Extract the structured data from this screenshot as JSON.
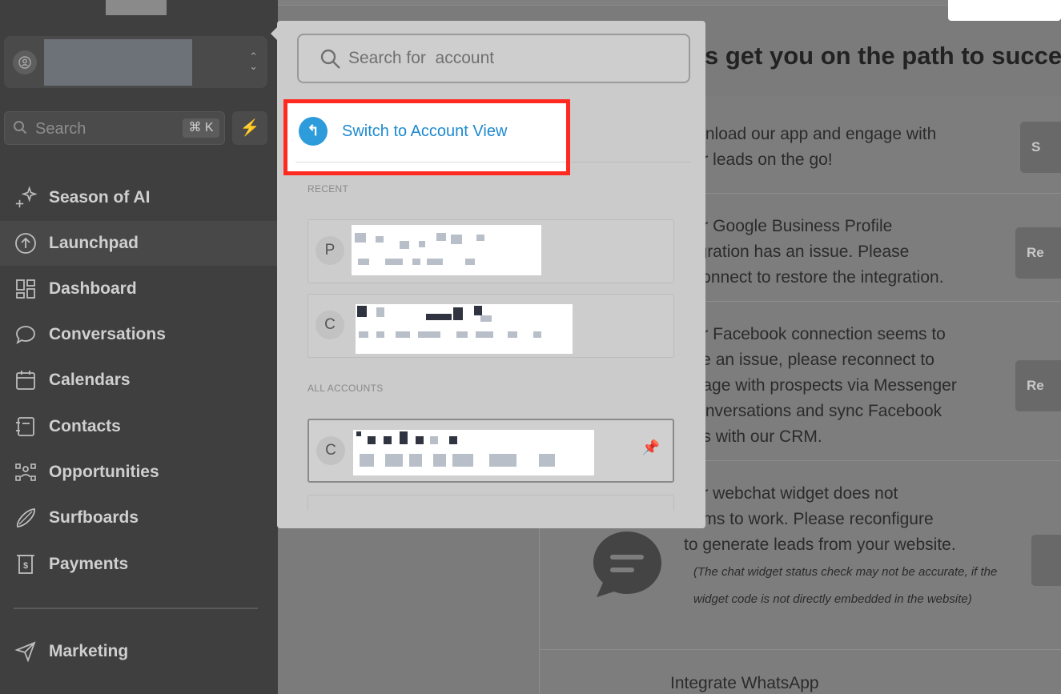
{
  "sidebar": {
    "search": {
      "placeholder": "Search",
      "shortcut": "⌘ K"
    },
    "items": [
      {
        "label": "Season of AI",
        "icon": "sparkle-icon"
      },
      {
        "label": "Launchpad",
        "icon": "rocket-icon",
        "active": true
      },
      {
        "label": "Dashboard",
        "icon": "grid-icon"
      },
      {
        "label": "Conversations",
        "icon": "chat-icon"
      },
      {
        "label": "Calendars",
        "icon": "calendar-icon"
      },
      {
        "label": "Contacts",
        "icon": "contacts-icon"
      },
      {
        "label": "Opportunities",
        "icon": "opportunities-icon"
      },
      {
        "label": "Surfboards",
        "icon": "surfboard-icon"
      },
      {
        "label": "Payments",
        "icon": "payments-icon"
      },
      {
        "label": "Marketing",
        "icon": "send-icon"
      }
    ]
  },
  "main": {
    "heading": "s get you on the path to success",
    "cards": [
      {
        "text": "ownload our app and engage with\nour leads on the go!",
        "button": "S"
      },
      {
        "text": "our Google Business Profile\ntegration has an issue. Please\neconnect to restore the integration.",
        "button": "Re"
      },
      {
        "text": "our Facebook connection seems to\nave an issue, please reconnect to\nngage with prospects via Messenger\n Conversations and sync Facebook\nads with our CRM.",
        "button": "Re"
      },
      {
        "text": "our webchat widget does not\neems to work. Please reconfigure\nto generate leads from your website.",
        "note": "(The chat widget status check may not be accurate, if the widget code is not directly embedded in the website)"
      }
    ],
    "whatsapp": "Integrate WhatsApp"
  },
  "popup": {
    "search_placeholder": "Search for  account",
    "switch_label": "Switch to Account View",
    "recent_label": "RECENT",
    "all_label": "ALL ACCOUNTS",
    "recent": [
      {
        "letter": "P"
      },
      {
        "letter": "C"
      }
    ],
    "all": [
      {
        "letter": "C"
      }
    ]
  },
  "colors": {
    "highlight_border": "#ff2a1f",
    "link_blue": "#1d8ad0",
    "switch_icon_bg": "#2e9bdb"
  }
}
